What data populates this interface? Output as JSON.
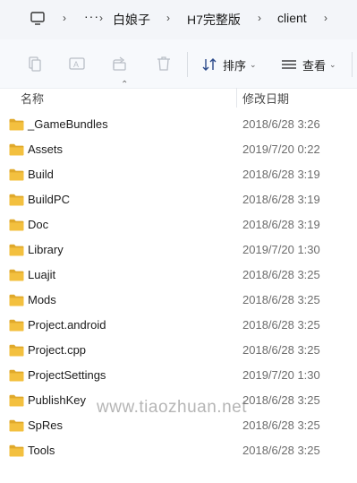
{
  "address": {
    "crumbs": [
      "白娘子",
      "H7完整版",
      "client"
    ],
    "overflow": "···"
  },
  "toolbar": {
    "sort_label": "排序",
    "view_label": "查看"
  },
  "columns": {
    "name": "名称",
    "date": "修改日期"
  },
  "files": [
    {
      "name": "_GameBundles",
      "date": "2018/6/28 3:26"
    },
    {
      "name": "Assets",
      "date": "2019/7/20 0:22"
    },
    {
      "name": "Build",
      "date": "2018/6/28 3:19"
    },
    {
      "name": "BuildPC",
      "date": "2018/6/28 3:19"
    },
    {
      "name": "Doc",
      "date": "2018/6/28 3:19"
    },
    {
      "name": "Library",
      "date": "2019/7/20 1:30"
    },
    {
      "name": "Luajit",
      "date": "2018/6/28 3:25"
    },
    {
      "name": "Mods",
      "date": "2018/6/28 3:25"
    },
    {
      "name": "Project.android",
      "date": "2018/6/28 3:25"
    },
    {
      "name": "Project.cpp",
      "date": "2018/6/28 3:25"
    },
    {
      "name": "ProjectSettings",
      "date": "2019/7/20 1:30"
    },
    {
      "name": "PublishKey",
      "date": "2018/6/28 3:25"
    },
    {
      "name": "SpRes",
      "date": "2018/6/28 3:25"
    },
    {
      "name": "Tools",
      "date": "2018/6/28 3:25"
    }
  ],
  "watermark": "www.tiaozhuan.net",
  "colors": {
    "folder": "#f3c03f",
    "folder_dark": "#e0a92b",
    "toolbar_bg": "#f7f9fc",
    "address_bg": "#f3f5f9"
  },
  "icons": [
    "computer-icon",
    "copy-icon",
    "rename-icon",
    "share-icon",
    "delete-icon",
    "sort-icon",
    "view-icon",
    "folder-icon"
  ]
}
